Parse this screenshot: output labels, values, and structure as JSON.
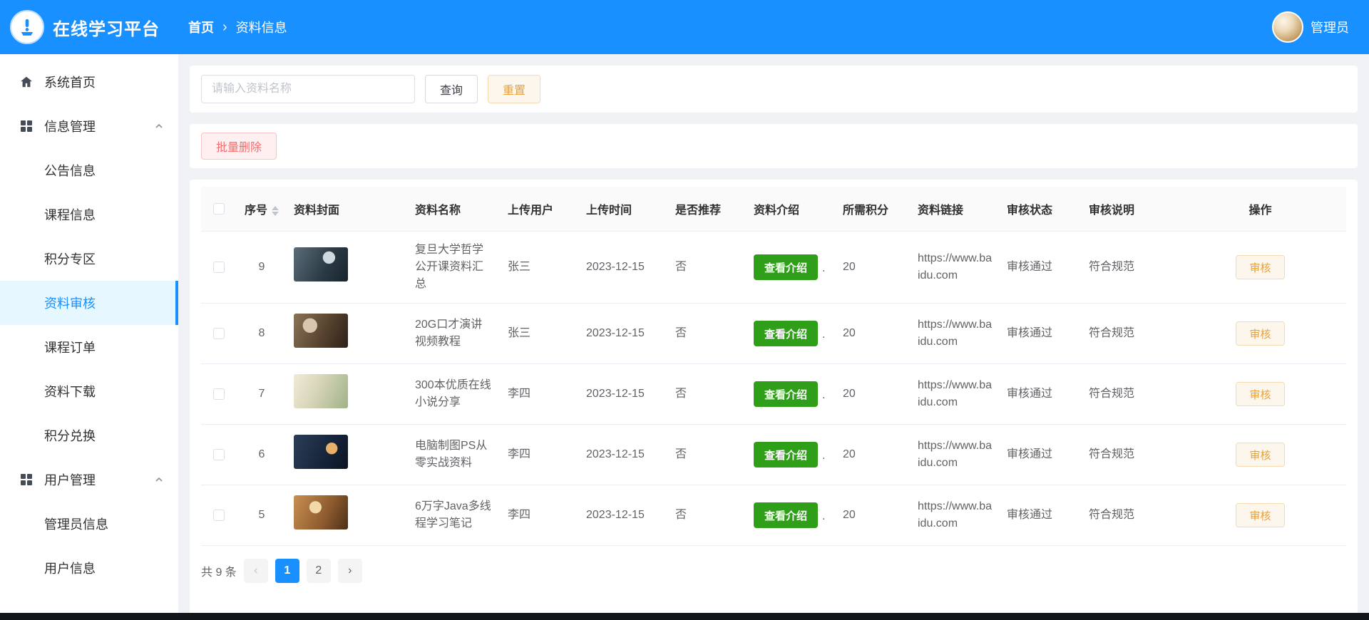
{
  "colors": {
    "primary": "#1890ff",
    "success": "#2f9e18",
    "warning": "#e6a23c",
    "danger": "#f56c6c"
  },
  "icons": {
    "logo": "speaker-podium-icon",
    "home": "home-icon",
    "group": "grid-icon",
    "collapse": "chevron-up-icon",
    "sort": "sort-carets-icon",
    "breadcrumb_separator": "chevron-right-icon",
    "pagination_prev": "chevron-left-icon",
    "pagination_next": "chevron-right-icon"
  },
  "header": {
    "app_title": "在线学习平台",
    "breadcrumb": {
      "home": "首页",
      "separator": "›",
      "current": "资料信息"
    },
    "user_name": "管理员"
  },
  "sidebar": {
    "home_label": "系统首页",
    "groups": [
      {
        "label": "信息管理",
        "children": [
          "公告信息",
          "课程信息",
          "积分专区",
          "资料审核",
          "课程订单",
          "资料下载",
          "积分兑换"
        ]
      },
      {
        "label": "用户管理",
        "children": [
          "管理员信息",
          "用户信息"
        ]
      }
    ],
    "active_item": "资料审核"
  },
  "search": {
    "placeholder": "请输入资料名称",
    "query_label": "查询",
    "reset_label": "重置"
  },
  "toolbar": {
    "batch_delete_label": "批量删除"
  },
  "table": {
    "columns": [
      "序号",
      "资料封面",
      "资料名称",
      "上传用户",
      "上传时间",
      "是否推荐",
      "资料介绍",
      "所需积分",
      "资料链接",
      "审核状态",
      "审核说明",
      "操作"
    ],
    "intro_button_label": "查看介绍",
    "intro_ellipsis": ".",
    "action_button_label": "审核",
    "rows": [
      {
        "no": "9",
        "name": "复旦大学哲学公开课资料汇总",
        "user": "张三",
        "time": "2023-12-15",
        "recommend": "否",
        "points": "20",
        "link": "https://www.baidu.com",
        "status": "审核通过",
        "remark": "符合规范"
      },
      {
        "no": "8",
        "name": "20G口才演讲视频教程",
        "user": "张三",
        "time": "2023-12-15",
        "recommend": "否",
        "points": "20",
        "link": "https://www.baidu.com",
        "status": "审核通过",
        "remark": "符合规范"
      },
      {
        "no": "7",
        "name": "300本优质在线小说分享",
        "user": "李四",
        "time": "2023-12-15",
        "recommend": "否",
        "points": "20",
        "link": "https://www.baidu.com",
        "status": "审核通过",
        "remark": "符合规范"
      },
      {
        "no": "6",
        "name": "电脑制图PS从零实战资料",
        "user": "李四",
        "time": "2023-12-15",
        "recommend": "否",
        "points": "20",
        "link": "https://www.baidu.com",
        "status": "审核通过",
        "remark": "符合规范"
      },
      {
        "no": "5",
        "name": "6万字Java多线程学习笔记",
        "user": "李四",
        "time": "2023-12-15",
        "recommend": "否",
        "points": "20",
        "link": "https://www.baidu.com",
        "status": "审核通过",
        "remark": "符合规范"
      }
    ]
  },
  "pagination": {
    "total_label": "共 9 条",
    "prev_icon": "‹",
    "pages": [
      "1",
      "2"
    ],
    "active_page": "1",
    "next_icon": "›"
  }
}
